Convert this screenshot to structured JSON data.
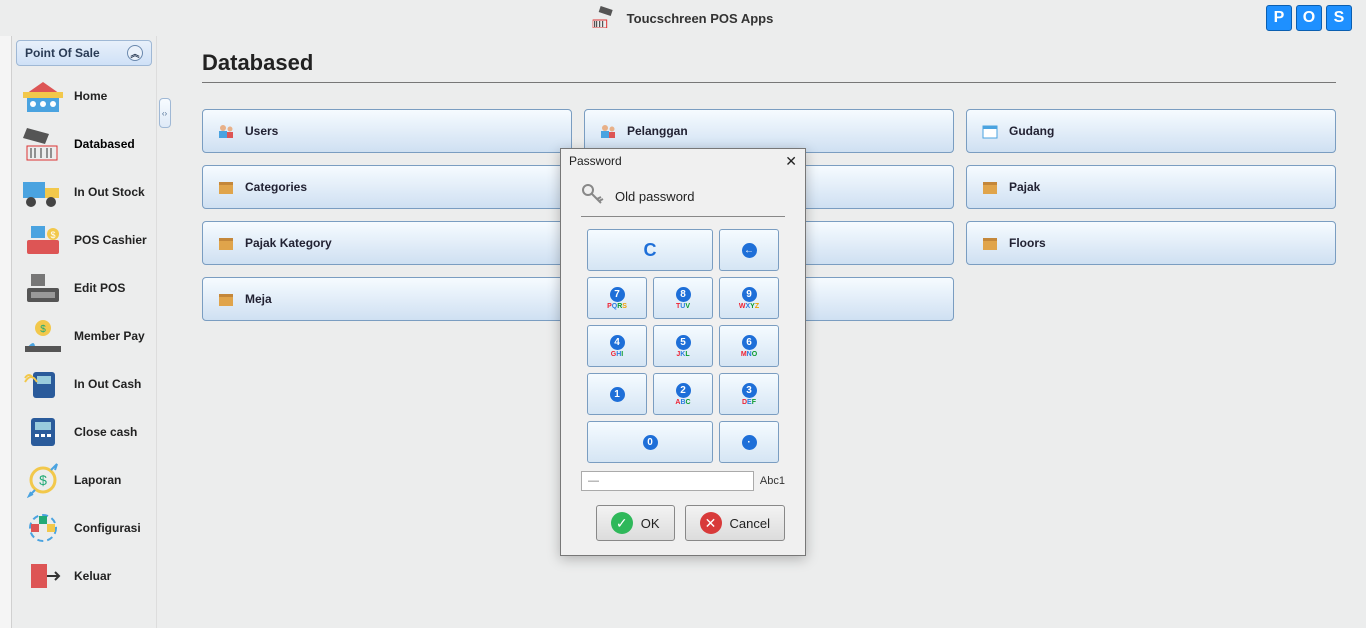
{
  "topbar": {
    "title": "Toucschreen POS Apps",
    "badges": [
      "P",
      "O",
      "S"
    ]
  },
  "sidebar": {
    "header": "Point Of Sale",
    "items": [
      {
        "label": "Home"
      },
      {
        "label": "Databased"
      },
      {
        "label": "In Out Stock"
      },
      {
        "label": "POS Cashier"
      },
      {
        "label": "Edit POS"
      },
      {
        "label": "Member Pay"
      },
      {
        "label": "In Out Cash"
      },
      {
        "label": "Close cash"
      },
      {
        "label": "Laporan"
      },
      {
        "label": "Configurasi"
      },
      {
        "label": "Keluar"
      }
    ]
  },
  "page": {
    "title": "Databased"
  },
  "tiles": [
    {
      "label": "Users",
      "name": "tile-users"
    },
    {
      "label": "Pelanggan",
      "name": "tile-pelanggan"
    },
    {
      "label": "Gudang",
      "name": "tile-gudang"
    },
    {
      "label": "Categories",
      "name": "tile-categories"
    },
    {
      "label": "",
      "name": "tile-blank-1"
    },
    {
      "label": "Pajak",
      "name": "tile-pajak"
    },
    {
      "label": "Pajak Kategory",
      "name": "tile-pajak-kategory"
    },
    {
      "label": "",
      "name": "tile-blank-2"
    },
    {
      "label": "Floors",
      "name": "tile-floors"
    },
    {
      "label": "Meja",
      "name": "tile-meja",
      "span": 2
    }
  ],
  "modal": {
    "title": "Password",
    "heading": "Old password",
    "clear": "C",
    "backspace": "←",
    "dot": "·",
    "keys": [
      {
        "num": "7",
        "letters": [
          "P",
          "Q",
          "R",
          "S"
        ]
      },
      {
        "num": "8",
        "letters": [
          "T",
          "U",
          "V"
        ]
      },
      {
        "num": "9",
        "letters": [
          "W",
          "X",
          "Y",
          "Z"
        ]
      },
      {
        "num": "4",
        "letters": [
          "G",
          "H",
          "I"
        ]
      },
      {
        "num": "5",
        "letters": [
          "J",
          "K",
          "L"
        ]
      },
      {
        "num": "6",
        "letters": [
          "M",
          "N",
          "O"
        ]
      },
      {
        "num": "1",
        "letters": []
      },
      {
        "num": "2",
        "letters": [
          "A",
          "B",
          "C"
        ]
      },
      {
        "num": "3",
        "letters": [
          "D",
          "E",
          "F"
        ]
      }
    ],
    "zero": "0",
    "input_placeholder": "—",
    "mode": "Abc1",
    "ok": "OK",
    "cancel": "Cancel"
  }
}
